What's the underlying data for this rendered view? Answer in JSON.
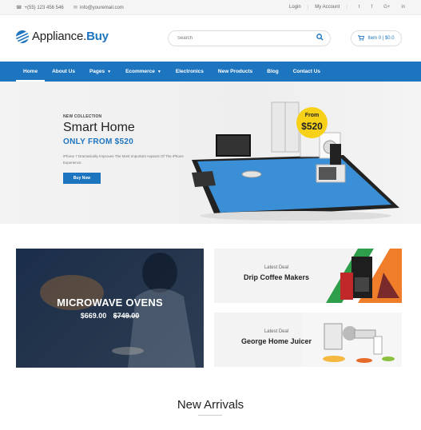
{
  "topbar": {
    "phone": "+(55) 123 456 546",
    "email": "info@youremail.com",
    "login": "Login",
    "account": "My Account",
    "social": [
      "t",
      "f",
      "G+",
      "in"
    ]
  },
  "header": {
    "logo_main": "Appliance.",
    "logo_accent": "Buy",
    "search_placeholder": "Search",
    "cart_text": "Item 0 | $0.0"
  },
  "nav": {
    "items": [
      {
        "label": "Home"
      },
      {
        "label": "About Us"
      },
      {
        "label": "Pages"
      },
      {
        "label": "Ecommerce"
      },
      {
        "label": "Electronics"
      },
      {
        "label": "New Products"
      },
      {
        "label": "Blog"
      },
      {
        "label": "Contact Us"
      }
    ]
  },
  "hero": {
    "tag": "NEW COLLECTION",
    "title": "Smart Home",
    "price": "ONLY FROM $520",
    "desc": "iPhone 7 Dramatically Improves The Most Important Aspects Of The iPhone Experience.",
    "button": "Buy Now",
    "badge_from": "From",
    "badge_amount": "$520"
  },
  "promos": {
    "left": {
      "title": "MICROWAVE OVENS",
      "price": "$669.00",
      "old_price": "$749.00"
    },
    "right1": {
      "label": "Latest Deal",
      "name": "Drip Coffee Makers"
    },
    "right2": {
      "label": "Latest Deal",
      "name": "George Home Juicer"
    }
  },
  "new_arrivals": {
    "title": "New Arrivals"
  },
  "colors": {
    "brand": "#1d74bf",
    "badge": "#f7d117"
  }
}
